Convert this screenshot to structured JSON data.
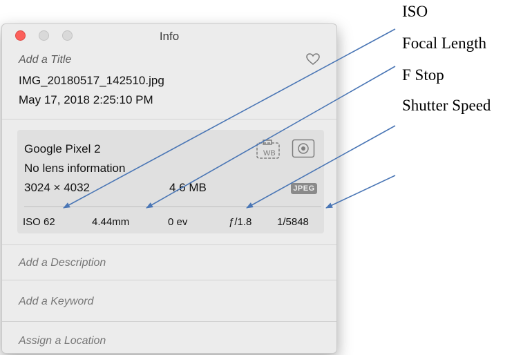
{
  "window": {
    "title": "Info"
  },
  "photo": {
    "title_placeholder": "Add a Title",
    "filename": "IMG_20180517_142510.jpg",
    "datetime": "May 17, 2018   2:25:10 PM",
    "favorite_icon": "heart-icon"
  },
  "exif": {
    "camera": "Google Pixel 2",
    "lens": "No lens information",
    "dimensions": "3024 × 4032",
    "file_size": "4.6 MB",
    "format_badge": "JPEG",
    "icons": [
      "white-balance-icon",
      "metering-icon"
    ],
    "iso": "ISO 62",
    "focal_length": "4.44mm",
    "exposure": "0 ev",
    "aperture": "ƒ/1.8",
    "shutter": "1/5848"
  },
  "fields": {
    "description_placeholder": "Add a Description",
    "keyword_placeholder": "Add a Keyword",
    "location_placeholder": "Assign a Location"
  },
  "annotations": {
    "iso": "ISO",
    "focal_length": "Focal Length",
    "f_stop": "F Stop",
    "shutter_speed": "Shutter Speed"
  },
  "colors": {
    "close_button": "#fc605b",
    "arrow": "#4a76b5",
    "panel_bg": "#ececec",
    "exif_bg": "#e0e0e0"
  }
}
